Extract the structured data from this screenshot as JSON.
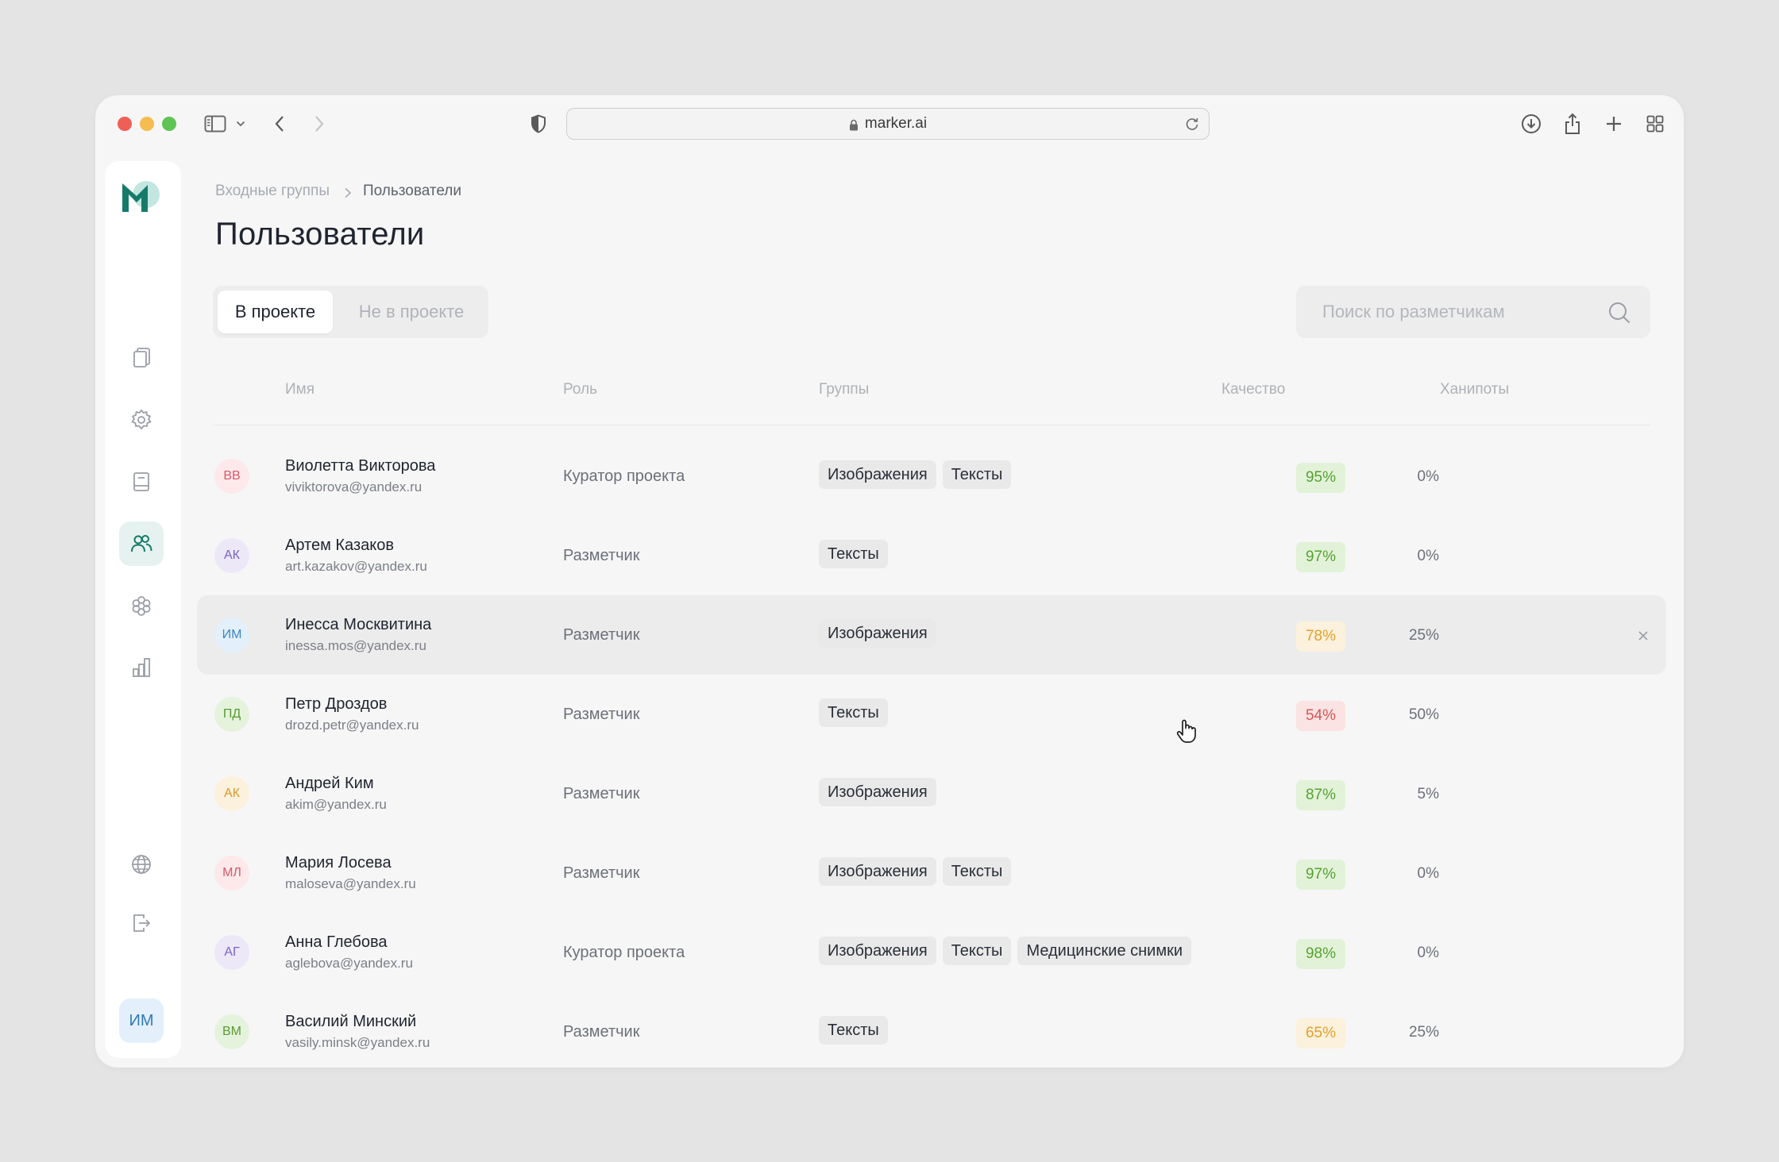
{
  "browser": {
    "url": "marker.ai"
  },
  "breadcrumb": {
    "parent": "Входные группы",
    "current": "Пользователи"
  },
  "page_title": "Пользователи",
  "tabs": [
    {
      "label": "В проекте",
      "active": true
    },
    {
      "label": "Не в проекте",
      "active": false
    }
  ],
  "search": {
    "placeholder": "Поиск по разметчикам"
  },
  "table": {
    "columns": {
      "name": "Имя",
      "role": "Роль",
      "groups": "Группы",
      "quality": "Качество",
      "honeypots": "Ханипоты"
    },
    "rows": [
      {
        "initials": "ВВ",
        "name": "Виолетта Викторова",
        "email": "viviktorova@yandex.ru",
        "role": "Куратор проекта",
        "groups": [
          "Изображения",
          "Тексты"
        ],
        "quality": "95%",
        "quality_level": "green",
        "honeypots": "0%",
        "avatar_bg": "#fde8ea",
        "avatar_fg": "#d65a6a"
      },
      {
        "initials": "АК",
        "name": "Артем Казаков",
        "email": "art.kazakov@yandex.ru",
        "role": "Разметчик",
        "groups": [
          "Тексты"
        ],
        "quality": "97%",
        "quality_level": "green",
        "honeypots": "0%",
        "avatar_bg": "#ece8f7",
        "avatar_fg": "#7b62c4"
      },
      {
        "initials": "ИМ",
        "name": "Инесса Москвитина",
        "email": "inessa.mos@yandex.ru",
        "role": "Разметчик",
        "groups": [
          "Изображения"
        ],
        "quality": "78%",
        "quality_level": "yellow",
        "honeypots": "25%",
        "avatar_bg": "#e3f0fb",
        "avatar_fg": "#3b86c4"
      },
      {
        "initials": "ПД",
        "name": "Петр Дроздов",
        "email": "drozd.petr@yandex.ru",
        "role": "Разметчик",
        "groups": [
          "Тексты"
        ],
        "quality": "54%",
        "quality_level": "red",
        "honeypots": "50%",
        "avatar_bg": "#e5f3dc",
        "avatar_fg": "#5a9a35"
      },
      {
        "initials": "АК",
        "name": "Андрей Ким",
        "email": "akim@yandex.ru",
        "role": "Разметчик",
        "groups": [
          "Изображения"
        ],
        "quality": "87%",
        "quality_level": "green",
        "honeypots": "5%",
        "avatar_bg": "#fcf1dc",
        "avatar_fg": "#d99a2a"
      },
      {
        "initials": "МЛ",
        "name": "Мария Лосева",
        "email": "maloseva@yandex.ru",
        "role": "Разметчик",
        "groups": [
          "Изображения",
          "Тексты"
        ],
        "quality": "97%",
        "quality_level": "green",
        "honeypots": "0%",
        "avatar_bg": "#fde8ea",
        "avatar_fg": "#d65a6a"
      },
      {
        "initials": "АГ",
        "name": "Анна Глебова",
        "email": "aglebova@yandex.ru",
        "role": "Куратор проекта",
        "groups": [
          "Изображения",
          "Тексты",
          "Медицинские снимки"
        ],
        "quality": "98%",
        "quality_level": "green",
        "honeypots": "0%",
        "avatar_bg": "#ece8f7",
        "avatar_fg": "#7b62c4"
      },
      {
        "initials": "ВМ",
        "name": "Василий Минский",
        "email": "vasily.minsk@yandex.ru",
        "role": "Разметчик",
        "groups": [
          "Тексты"
        ],
        "quality": "65%",
        "quality_level": "yellow",
        "honeypots": "25%",
        "avatar_bg": "#e5f3dc",
        "avatar_fg": "#5a9a35"
      }
    ],
    "hovered_row": 2
  },
  "current_user": {
    "initials": "ИМ"
  },
  "icons": {
    "sidebar": [
      "documents-icon",
      "settings-icon",
      "book-icon",
      "users-icon",
      "components-icon",
      "chart-icon",
      "globe-icon",
      "logout-icon"
    ],
    "active_sidebar": "users-icon",
    "accent": "#167a6a"
  }
}
